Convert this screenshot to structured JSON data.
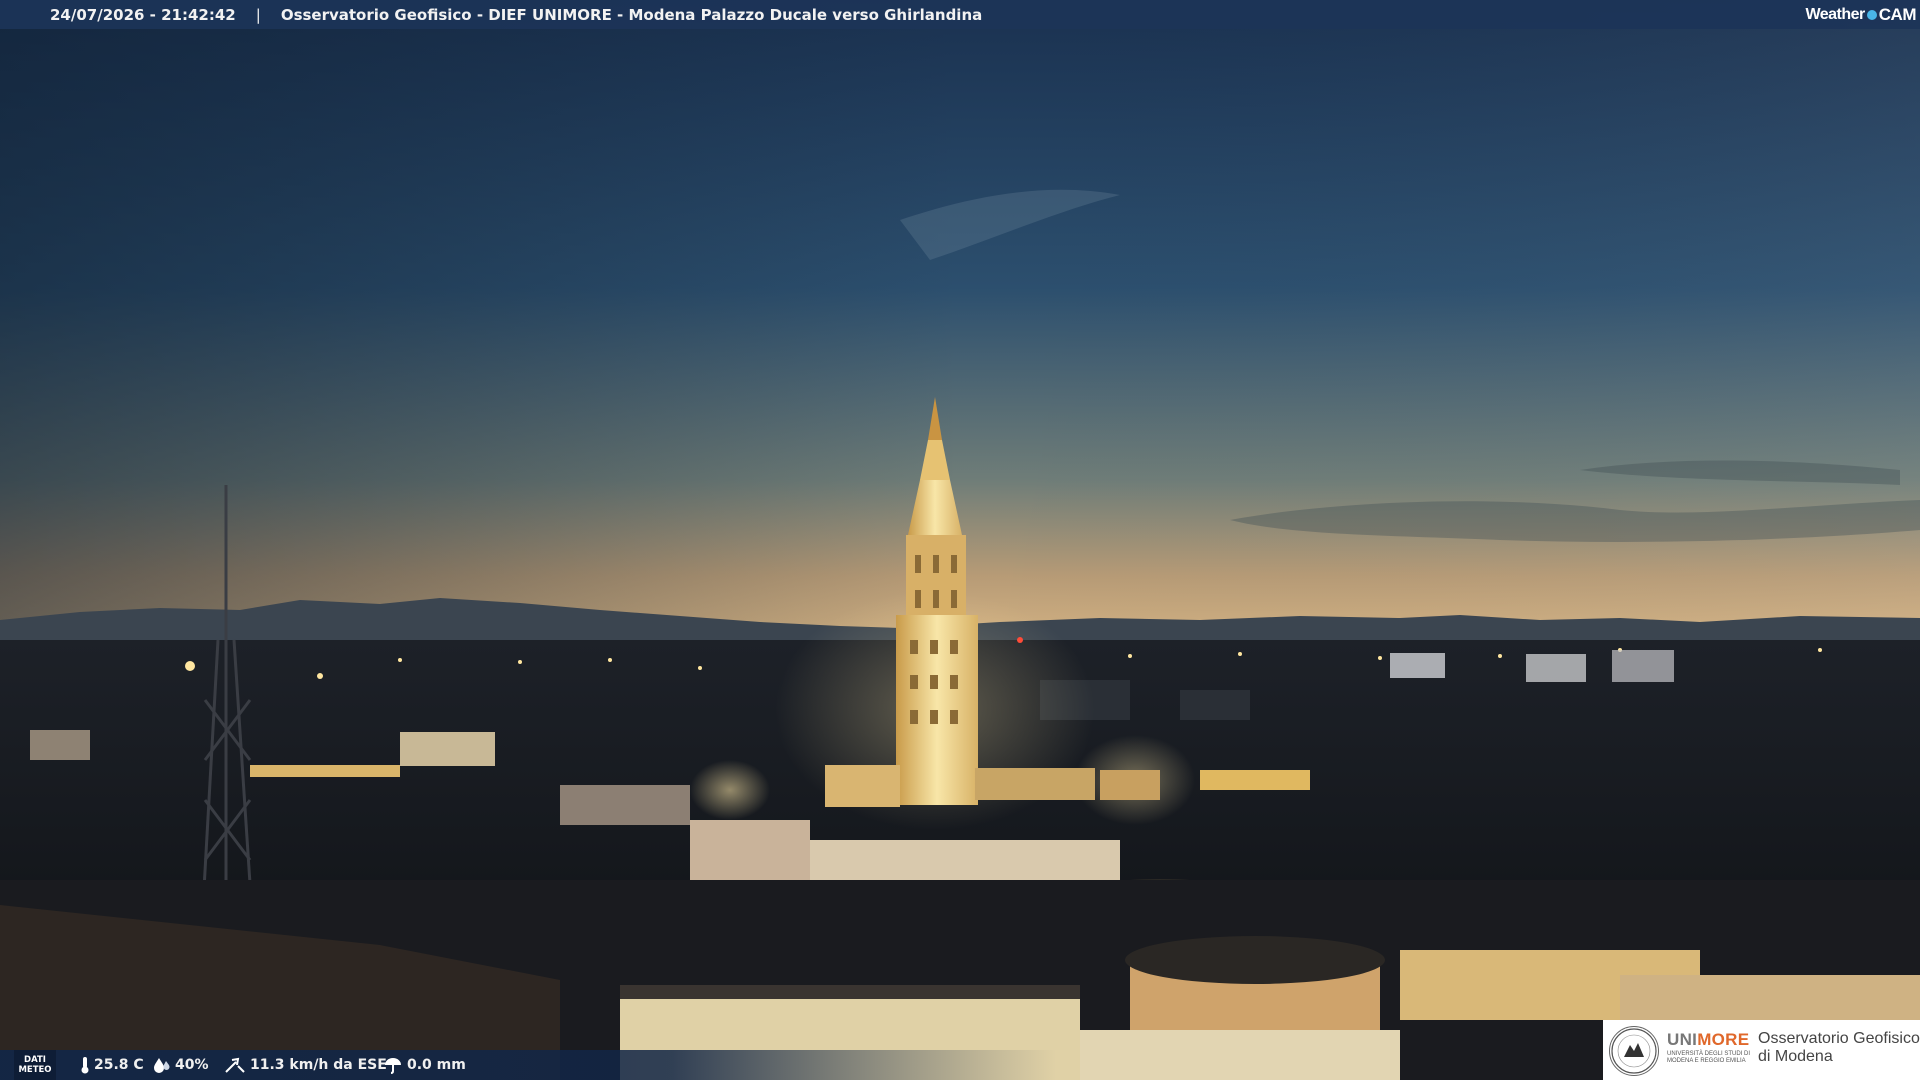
{
  "header": {
    "timestamp": "24/07/2026 - 21:42:42",
    "separator": "|",
    "title": "Osservatorio Geofisico - DIEF UNIMORE - Modena Palazzo Ducale verso Ghirlandina"
  },
  "brand_logo": {
    "prefix": "Weather",
    "suffix": "CAM"
  },
  "weather": {
    "badge_line1": "DATI",
    "badge_line2": "METEO",
    "temperature": "25.8 C",
    "humidity": "40%",
    "wind": "11.3 km/h da ESE",
    "rain": "0.0 mm",
    "icons": [
      "thermometer-icon",
      "humidity-drop-icon",
      "wind-icon",
      "rain-icon"
    ]
  },
  "footer_logo": {
    "brand_part1": "UNI",
    "brand_part2": "MORE",
    "university_line": "UNIVERSITÀ DEGLI STUDI DI MODENA E REGGIO EMILIA",
    "observatory_line1": "Osservatorio Geofisico",
    "observatory_line2": "di Modena"
  },
  "colors": {
    "header_bar": "#1c3458",
    "sky_top": "#1e3553",
    "sky_horizon": "#c9a67a",
    "tower_light": "#f4d68a",
    "unimore_orange": "#e0682b",
    "weathercam_blue": "#49b6e8"
  }
}
